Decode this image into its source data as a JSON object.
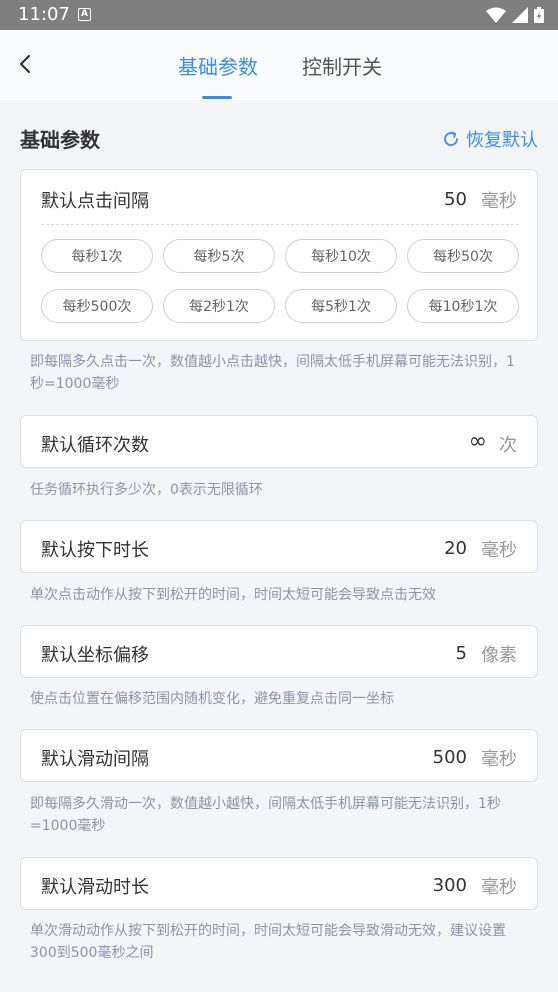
{
  "status": {
    "time": "11:07",
    "notif": "A"
  },
  "header": {
    "tabs": [
      {
        "label": "基础参数",
        "active": true
      },
      {
        "label": "控制开关",
        "active": false
      }
    ]
  },
  "section": {
    "title": "基础参数",
    "restore_label": "恢复默认"
  },
  "click_interval": {
    "label": "默认点击间隔",
    "value": "50",
    "unit": "毫秒",
    "presets": [
      "每秒1次",
      "每秒5次",
      "每秒10次",
      "每秒50次",
      "每秒500次",
      "每2秒1次",
      "每5秒1次",
      "每10秒1次"
    ],
    "hint": "即每隔多久点击一次，数值越小点击越快，间隔太低手机屏幕可能无法识别，1秒=1000毫秒"
  },
  "loop_count": {
    "label": "默认循环次数",
    "value": "∞",
    "unit": "次",
    "hint": "任务循环执行多少次，0表示无限循环"
  },
  "press_duration": {
    "label": "默认按下时长",
    "value": "20",
    "unit": "毫秒",
    "hint": "单次点击动作从按下到松开的时间，时间太短可能会导致点击无效"
  },
  "coord_offset": {
    "label": "默认坐标偏移",
    "value": "5",
    "unit": "像素",
    "hint": "使点击位置在偏移范围内随机变化，避免重复点击同一坐标"
  },
  "swipe_interval": {
    "label": "默认滑动间隔",
    "value": "500",
    "unit": "毫秒",
    "hint": "即每隔多久滑动一次，数值越小越快，间隔太低手机屏幕可能无法识别，1秒=1000毫秒"
  },
  "swipe_duration": {
    "label": "默认滑动时长",
    "value": "300",
    "unit": "毫秒",
    "hint": "单次滑动动作从按下到松开的时间，时间太短可能会导致滑动无效，建议设置300到500毫秒之间"
  },
  "colors": {
    "accent": "#3a8ee6",
    "hint": "#8a94a6",
    "border": "#dcdfe6"
  }
}
